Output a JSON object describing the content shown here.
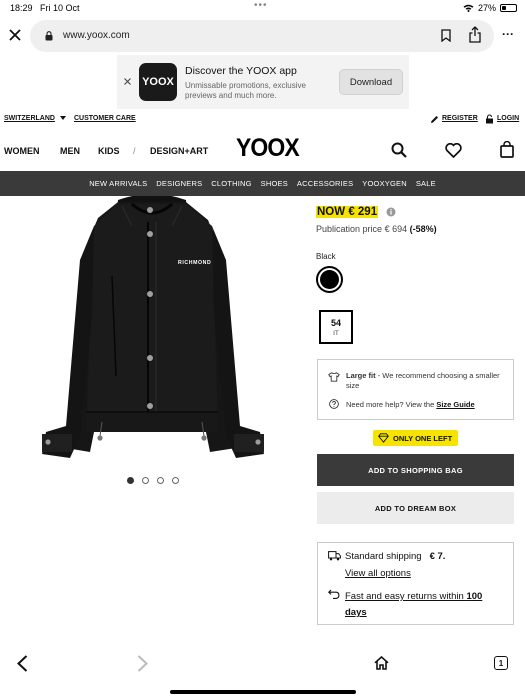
{
  "status_bar": {
    "time": "18:29",
    "date": "Fri 10 Oct",
    "battery": "27%",
    "battery_level": 0.27
  },
  "browser": {
    "url": "www.yoox.com"
  },
  "promo": {
    "logo_text": "YOOX",
    "title": "Discover the YOOX app",
    "subtitle": "Unmissable promotions, exclusive previews and much more.",
    "button": "Download"
  },
  "top_links": {
    "country": "SWITZERLAND",
    "customer_care": "CUSTOMER CARE",
    "register": "REGISTER",
    "login": "LOGIN"
  },
  "nav": {
    "women": "WOMEN",
    "men": "MEN",
    "kids": "KIDS",
    "separator": "/",
    "design_art": "DESIGN+ART",
    "logo": "YOOX"
  },
  "categories": [
    "NEW ARRIVALS",
    "DESIGNERS",
    "CLOTHING",
    "SHOES",
    "ACCESSORIES",
    "YOOXYGEN",
    "SALE"
  ],
  "product": {
    "jacket_text": "RICHMOND",
    "image_count": 4,
    "active_image": 0,
    "price_now_label": "NOW",
    "price_now": "€ 291",
    "publication_price_label": "Publication price",
    "publication_price": "€ 694",
    "discount": "(-58%)",
    "color_label": "Black",
    "size_num": "54",
    "size_unit": "IT",
    "fit_title": "Large fit",
    "fit_text": " - We recommend choosing a smaller size",
    "help_text": "Need more help? View the ",
    "size_guide": "Size Guide",
    "only_one_left": "ONLY ONE LEFT",
    "add_to_bag": "ADD TO SHOPPING BAG",
    "add_to_dream": "ADD TO DREAM BOX"
  },
  "shipping": {
    "standard": "Standard shipping",
    "standard_price": "€ 7.",
    "view_options": "View all options",
    "returns_prefix": "Fast and easy returns within ",
    "returns_days": "100 days"
  },
  "bottom_bar": {
    "tabs_count": "1"
  },
  "colors": {
    "accent": "#f6e400",
    "dark_bar": "#3a3a3a"
  }
}
